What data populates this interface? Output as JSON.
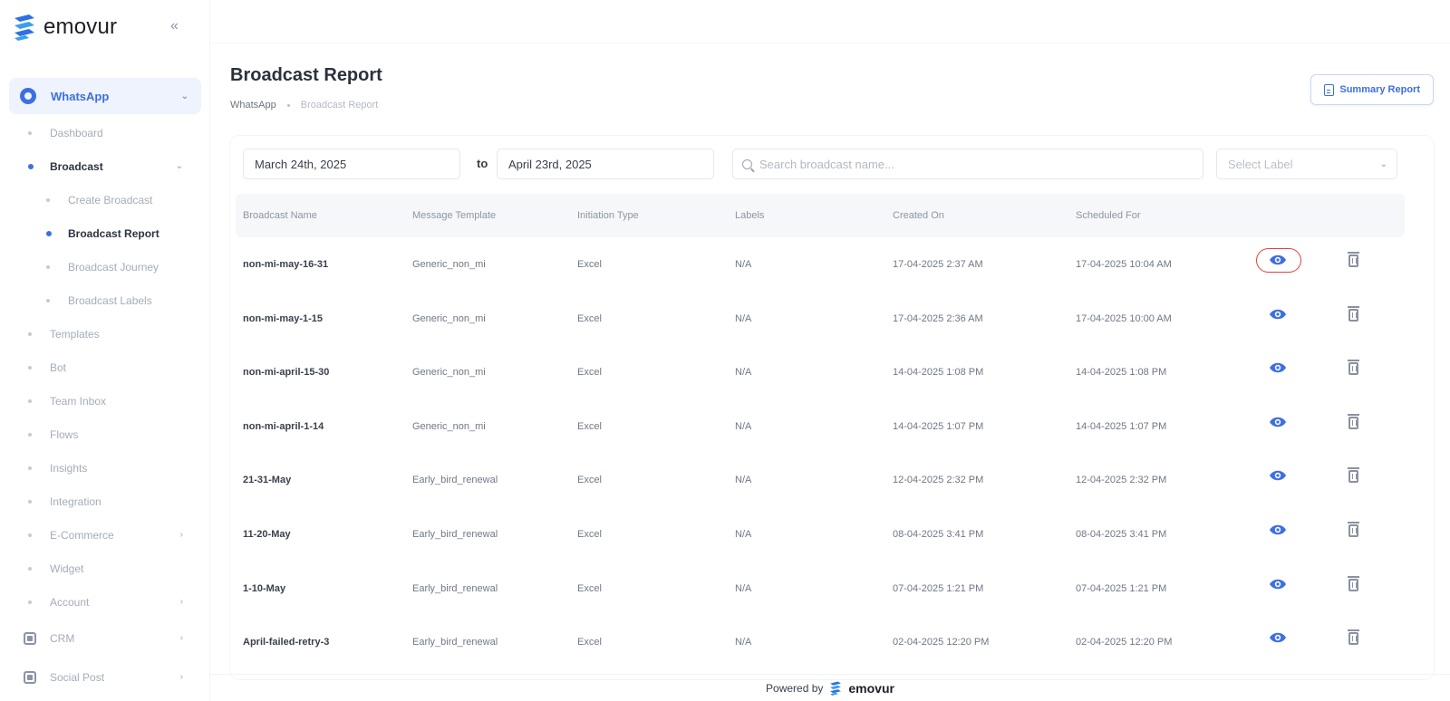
{
  "brand": {
    "name": "emovur"
  },
  "sidebar": {
    "whatsapp_label": "WhatsApp",
    "items": [
      {
        "label": "Dashboard"
      },
      {
        "label": "Broadcast"
      },
      {
        "label": "Create Broadcast"
      },
      {
        "label": "Broadcast Report"
      },
      {
        "label": "Broadcast Journey"
      },
      {
        "label": "Broadcast Labels"
      },
      {
        "label": "Templates"
      },
      {
        "label": "Bot"
      },
      {
        "label": "Team Inbox"
      },
      {
        "label": "Flows"
      },
      {
        "label": "Insights"
      },
      {
        "label": "Integration"
      },
      {
        "label": "E-Commerce"
      },
      {
        "label": "Widget"
      },
      {
        "label": "Account"
      }
    ],
    "crm_label": "CRM",
    "social_label": "Social Post"
  },
  "page": {
    "title": "Broadcast Report",
    "breadcrumb": [
      "WhatsApp",
      "Broadcast Report"
    ],
    "summary_button": "Summary Report"
  },
  "filters": {
    "date_from": "March 24th, 2025",
    "to_label": "to",
    "date_to": "April 23rd, 2025",
    "search_placeholder": "Search broadcast name...",
    "label_select": "Select Label"
  },
  "table": {
    "columns": [
      "Broadcast Name",
      "Message Template",
      "Initiation Type",
      "Labels",
      "Created On",
      "Scheduled For"
    ],
    "rows": [
      {
        "name": "non-mi-may-16-31",
        "template": "Generic_non_mi",
        "type": "Excel",
        "labels": "N/A",
        "created": "17-04-2025 2:37 AM",
        "scheduled": "17-04-2025 10:04 AM"
      },
      {
        "name": "non-mi-may-1-15",
        "template": "Generic_non_mi",
        "type": "Excel",
        "labels": "N/A",
        "created": "17-04-2025 2:36 AM",
        "scheduled": "17-04-2025 10:00 AM"
      },
      {
        "name": "non-mi-april-15-30",
        "template": "Generic_non_mi",
        "type": "Excel",
        "labels": "N/A",
        "created": "14-04-2025 1:08 PM",
        "scheduled": "14-04-2025 1:08 PM"
      },
      {
        "name": "non-mi-april-1-14",
        "template": "Generic_non_mi",
        "type": "Excel",
        "labels": "N/A",
        "created": "14-04-2025 1:07 PM",
        "scheduled": "14-04-2025 1:07 PM"
      },
      {
        "name": "21-31-May",
        "template": "Early_bird_renewal",
        "type": "Excel",
        "labels": "N/A",
        "created": "12-04-2025 2:32 PM",
        "scheduled": "12-04-2025 2:32 PM"
      },
      {
        "name": "11-20-May",
        "template": "Early_bird_renewal",
        "type": "Excel",
        "labels": "N/A",
        "created": "08-04-2025 3:41 PM",
        "scheduled": "08-04-2025 3:41 PM"
      },
      {
        "name": "1-10-May",
        "template": "Early_bird_renewal",
        "type": "Excel",
        "labels": "N/A",
        "created": "07-04-2025 1:21 PM",
        "scheduled": "07-04-2025 1:21 PM"
      },
      {
        "name": "April-failed-retry-3",
        "template": "Early_bird_renewal",
        "type": "Excel",
        "labels": "N/A",
        "created": "02-04-2025 12:20 PM",
        "scheduled": "02-04-2025 12:20 PM"
      }
    ]
  },
  "footer": {
    "powered_by": "Powered by",
    "brand": "emovur"
  },
  "colors": {
    "accent": "#3d6fe0",
    "highlight_ring": "#e0413a"
  }
}
